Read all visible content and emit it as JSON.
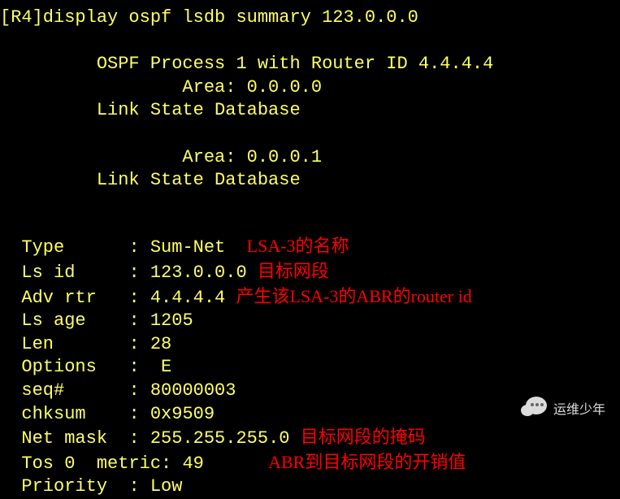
{
  "prompt": "[R4]display ospf lsdb summary 123.0.0.0",
  "header": {
    "process": "         OSPF Process 1 with Router ID 4.4.4.4",
    "area0": "                 Area: 0.0.0.0",
    "lsdb0": "         Link State Database",
    "area1": "                 Area: 0.0.0.1",
    "lsdb1": "         Link State Database"
  },
  "fields": {
    "type": {
      "label": "  Type      ",
      "sep": ": ",
      "value": "Sum-Net  ",
      "note": "LSA-3的名称"
    },
    "lsid": {
      "label": "  Ls id     ",
      "sep": ": ",
      "value": "123.0.0.0 ",
      "note": "目标网段"
    },
    "advrtr": {
      "label": "  Adv rtr   ",
      "sep": ": ",
      "value": "4.4.4.4 ",
      "note": "产生该LSA-3的ABR的router id"
    },
    "lsage": {
      "label": "  Ls age    ",
      "sep": ": ",
      "value": "1205",
      "note": ""
    },
    "len": {
      "label": "  Len       ",
      "sep": ": ",
      "value": "28",
      "note": ""
    },
    "options": {
      "label": "  Options   ",
      "sep": ":  ",
      "value": "E",
      "note": ""
    },
    "seq": {
      "label": "  seq#      ",
      "sep": ": ",
      "value": "80000003",
      "note": ""
    },
    "chksum": {
      "label": "  chksum    ",
      "sep": ": ",
      "value": "0x9509",
      "note": ""
    },
    "netmask": {
      "label": "  Net mask  ",
      "sep": ": ",
      "value": "255.255.255.0 ",
      "note": "目标网段的掩码"
    },
    "tos": {
      "label": "  Tos 0  metric",
      "sep": ": ",
      "value": "49      ",
      "note": "ABR到目标网段的开销值"
    },
    "priority": {
      "label": "  Priority  ",
      "sep": ": ",
      "value": "Low",
      "note": ""
    }
  },
  "watermark": "运维少年"
}
